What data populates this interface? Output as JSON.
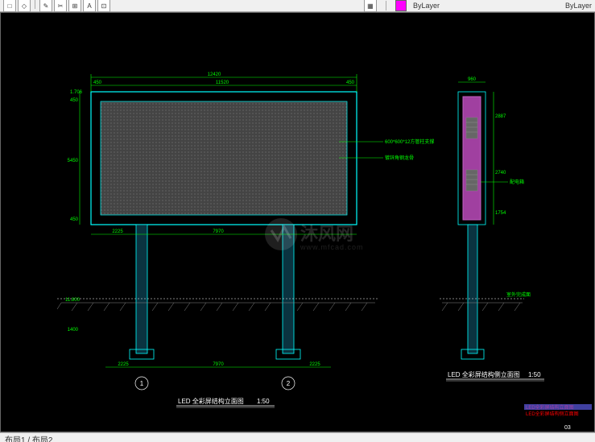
{
  "toolbar": {
    "layer_label": "ByLayer",
    "swatch_color": "#ff00ff"
  },
  "front_view": {
    "title": "LED 全彩屏结构立面图",
    "scale": "1:50",
    "dims_top": {
      "overall": "12420",
      "left_margin": "450",
      "mid": "11520",
      "right_margin": "450"
    },
    "dims_left": {
      "top": "1.706",
      "seg1": "450",
      "seg2": "5450",
      "seg3": "450",
      "elev_lower": "11.800",
      "ground_depth": "1400"
    },
    "dims_bottom": {
      "l1": "2225",
      "l2": "7970",
      "left_off": "2225",
      "span": "7970",
      "right_off": "2225"
    },
    "grid": {
      "1": "1",
      "2": "2"
    },
    "callouts": {
      "a": "600*600*12方管柱支撑",
      "b": "镀锌角钢龙骨"
    }
  },
  "side_view": {
    "title": "LED 全彩屏结构侧立面图",
    "scale": "1:50",
    "dims_top": {
      "w": "960"
    },
    "dims_right": {
      "h1": "2887",
      "h2": "2740",
      "h3": "1754"
    },
    "callout": "配电箱",
    "ground": "室外完成面"
  },
  "page_labels": {
    "line1": "LED全彩屏结构立面图",
    "line2": "LED全彩屏结构侧立面图"
  },
  "page_num": "03",
  "watermark": {
    "text": "沐风网",
    "url": "www.mfcad.com"
  },
  "footer": {
    "tabs": "布局1 / 布局2"
  }
}
